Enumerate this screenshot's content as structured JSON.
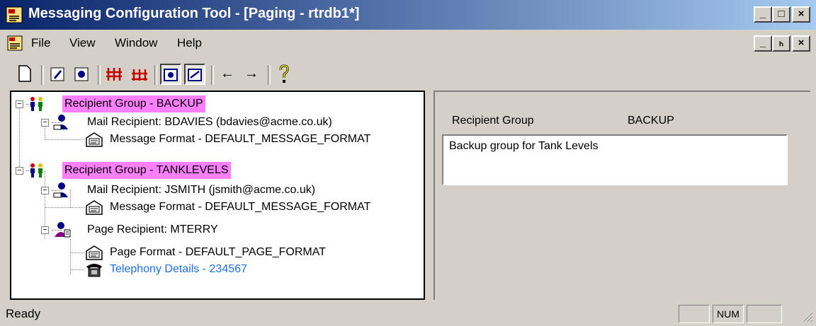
{
  "window": {
    "title": "Messaging Configuration Tool - [Paging - rtrdb1*]",
    "minimize": "_",
    "maximize": "□",
    "close": "×",
    "restore": "ₕ"
  },
  "menu": {
    "items": [
      "File",
      "View",
      "Window",
      "Help"
    ]
  },
  "toolbar": {
    "buttons": [
      {
        "icon": "new-document-icon",
        "glyph": "🗋"
      },
      {
        "icon": "edit-icon",
        "glyph": "✎"
      },
      {
        "icon": "properties-icon",
        "glyph": "▣"
      },
      {
        "icon": "add-group-icon",
        "glyph": "⧻"
      },
      {
        "icon": "remove-group-icon",
        "glyph": "⧺"
      },
      {
        "icon": "view-list-icon",
        "glyph": "▦"
      },
      {
        "icon": "view-detail-icon",
        "glyph": "▧"
      },
      {
        "icon": "arrow-left-icon",
        "glyph": "←"
      },
      {
        "icon": "arrow-right-icon",
        "glyph": "→"
      },
      {
        "icon": "help-icon",
        "glyph": "?"
      }
    ]
  },
  "tree": {
    "nodes": [
      {
        "label": "Recipient Group - BACKUP",
        "type": "group",
        "highlight": true
      },
      {
        "label": "Mail Recipient: BDAVIES (bdavies@acme.co.uk)",
        "type": "mail-recipient"
      },
      {
        "label": "Message Format - DEFAULT_MESSAGE_FORMAT",
        "type": "format"
      },
      {
        "label": "Recipient Group - TANKLEVELS",
        "type": "group",
        "highlight": true
      },
      {
        "label": "Mail Recipient: JSMITH (jsmith@acme.co.uk)",
        "type": "mail-recipient"
      },
      {
        "label": "Message Format - DEFAULT_MESSAGE_FORMAT",
        "type": "format"
      },
      {
        "label": "Page Recipient: MTERRY",
        "type": "page-recipient"
      },
      {
        "label": "Page Format - DEFAULT_PAGE_FORMAT",
        "type": "format"
      },
      {
        "label": "Telephony Details - 234567",
        "type": "telephony",
        "link": true
      }
    ]
  },
  "detail": {
    "field_label": "Recipient Group",
    "field_value": "BACKUP",
    "description": "Backup group for Tank Levels"
  },
  "status": {
    "text": "Ready",
    "panel_num": "NUM"
  },
  "colors": {
    "highlight": "#ff80ff",
    "link": "#1e6ee8",
    "titlebar_start": "#0a246a",
    "titlebar_end": "#a6caf0"
  }
}
